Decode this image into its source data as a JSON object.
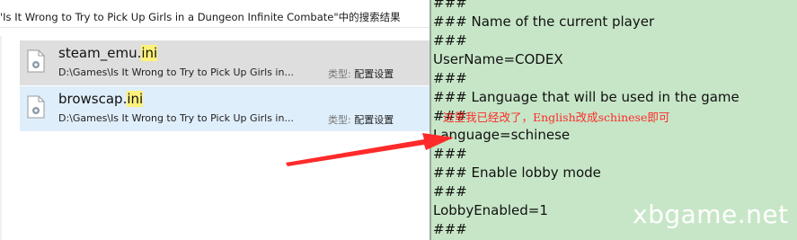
{
  "search": {
    "title": "'Is It Wrong to Try to Pick Up Girls in a Dungeon Infinite Combate\"中的搜索结果"
  },
  "results": [
    {
      "name_before": "steam_emu.",
      "name_highlight": "ini",
      "path": "D:\\Games\\Is It Wrong to Try to Pick Up Girls in...",
      "type_label": "类型:",
      "type_value": "配置设置"
    },
    {
      "name_before": "browscap.",
      "name_highlight": "ini",
      "path": "D:\\Games\\Is It Wrong to Try to Pick Up Girls in...",
      "type_label": "类型:",
      "type_value": "配置设置"
    }
  ],
  "editor": {
    "lines": [
      "###",
      "### Name of the current player",
      "###",
      "UserName=CODEX",
      "###",
      "### Language that will be used in the game",
      "###",
      "Language=schinese",
      "###",
      "### Enable lobby mode",
      "###",
      "LobbyEnabled=1",
      "###"
    ]
  },
  "annotation": {
    "note": "这里我已经改了，English改成schinese即可",
    "color": "#ff2a2a"
  },
  "watermark": "xbgame.net",
  "colors": {
    "editor_bg": "#c7e6c7",
    "highlight": "#fff27a",
    "selected_row": "#dedede",
    "hover_row": "#dfeefb"
  }
}
